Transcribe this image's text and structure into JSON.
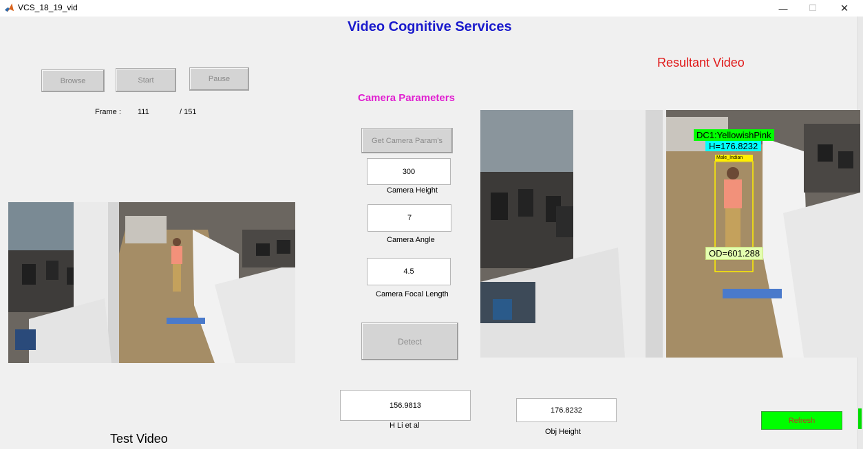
{
  "window": {
    "title": "VCS_18_19_vid",
    "minimize_glyph": "—",
    "maximize_glyph": "☐",
    "close_glyph": "✕",
    "icon": "matlab-icon"
  },
  "header": {
    "title": "Video Cognitive Services"
  },
  "controls": {
    "browse_label": "Browse",
    "start_label": "Start",
    "pause_label": "Pause",
    "frame_label": "Frame :",
    "frame_current": "111",
    "frame_total": "/ 151"
  },
  "camera": {
    "title": "Camera Parameters",
    "get_params_label": "Get Camera Param's",
    "height_value": "300",
    "height_label": "Camera Height",
    "angle_value": "7",
    "angle_label": "Camera Angle",
    "focal_value": "4.5",
    "focal_label": "Camera Focal Length",
    "detect_label": "Detect"
  },
  "results": {
    "title": "Resultant Video",
    "overlay_dc": "DC1:YellowishPink",
    "overlay_h": "H=176.8232",
    "overlay_class": "Male_Indian",
    "overlay_od": "OD=601.288",
    "hli_value": "156.9813",
    "hli_label": "H Li et al",
    "obj_value": "176.8232",
    "obj_label": "Obj Height",
    "refresh_label": "Refresh"
  },
  "test": {
    "title": "Test Video"
  },
  "colors": {
    "title_blue": "#1a1acc",
    "result_red": "#e01818",
    "camera_magenta": "#e020d0",
    "refresh_green": "#00ff00",
    "bbox_yellow": "#ffee00",
    "label_cyan": "#00ffff"
  }
}
